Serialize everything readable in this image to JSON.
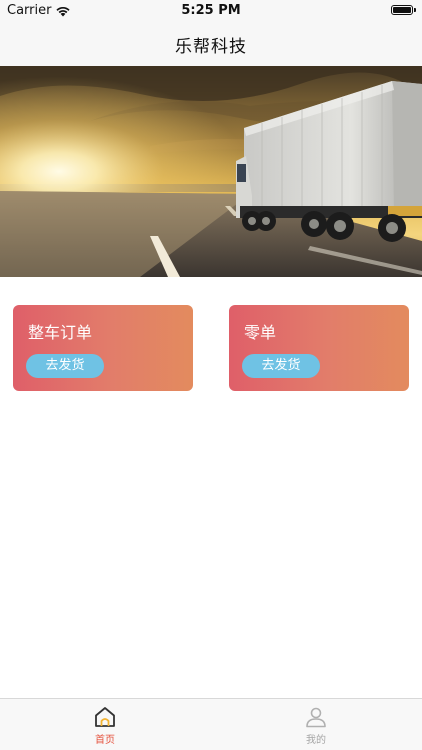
{
  "status_bar": {
    "carrier": "Carrier",
    "time": "5:25 PM",
    "battery_level": 1.0
  },
  "nav": {
    "title": "乐帮科技"
  },
  "banner": {
    "image_description": "truck on highway at sunset",
    "page_count": 1,
    "current_page": 1
  },
  "cards": [
    {
      "title": "整车订单",
      "button_label": "去发货"
    },
    {
      "title": "零单",
      "button_label": "去发货"
    }
  ],
  "tab_bar": {
    "items": [
      {
        "label": "首页",
        "icon": "home-icon",
        "selected": true,
        "color": "#e5533f"
      },
      {
        "label": "我的",
        "icon": "user-icon",
        "selected": false,
        "color": "#a5a5a5"
      }
    ]
  },
  "colors": {
    "card_gradient_start": "#df5f69",
    "card_gradient_end": "#e38b5e",
    "button_blue": "#6fc2e4",
    "accent": "#e5533f"
  }
}
